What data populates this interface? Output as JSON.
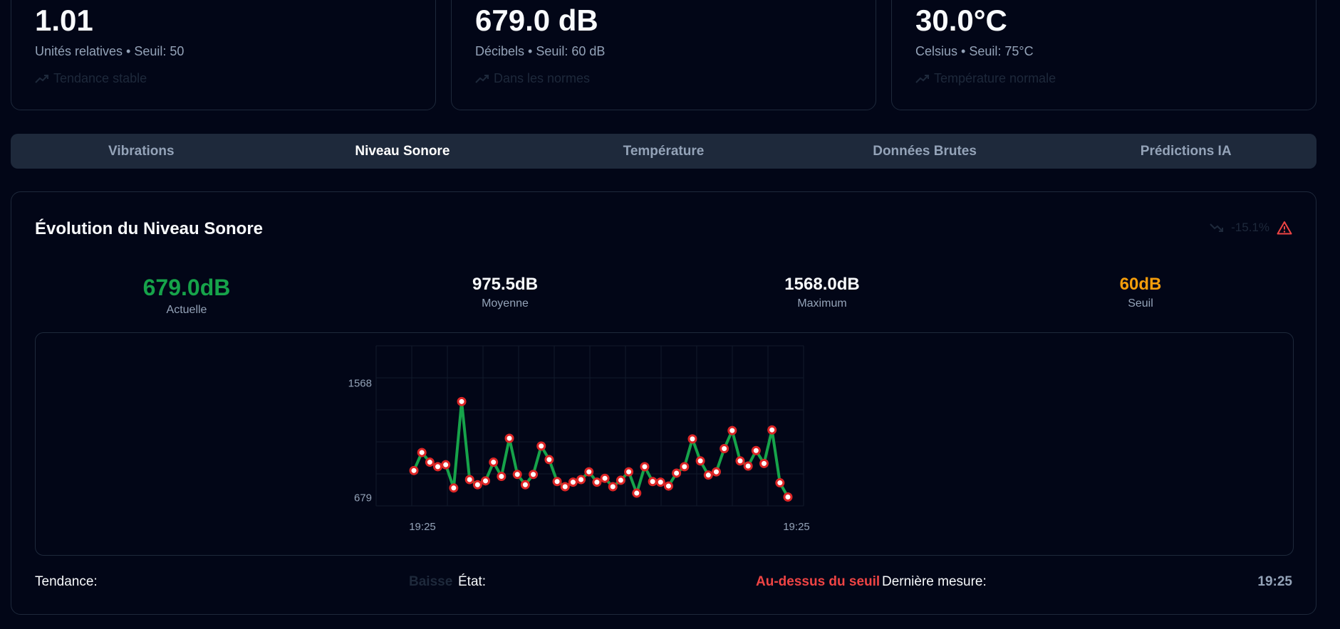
{
  "cards": [
    {
      "value": "1.01",
      "subtitle": "Unités relatives • Seuil: 50",
      "trend": "Tendance stable",
      "trend_icon": "trending-up-icon"
    },
    {
      "value": "679.0 dB",
      "subtitle": "Décibels • Seuil: 60 dB",
      "trend": "Dans les normes",
      "trend_icon": "trending-up-icon"
    },
    {
      "value": "30.0°C",
      "subtitle": "Celsius • Seuil: 75°C",
      "trend": "Température normale",
      "trend_icon": "trending-up-icon"
    }
  ],
  "tabs": [
    {
      "label": "Vibrations",
      "active": false
    },
    {
      "label": "Niveau Sonore",
      "active": true
    },
    {
      "label": "Température",
      "active": false
    },
    {
      "label": "Données Brutes",
      "active": false
    },
    {
      "label": "Prédictions IA",
      "active": false
    }
  ],
  "panel": {
    "title": "Évolution du Niveau Sonore",
    "change": "-15.1%",
    "change_icon": "trending-down-icon",
    "alert_icon": "warning-triangle-icon",
    "stats": [
      {
        "value": "679.0dB",
        "label": "Actuelle",
        "color": "#16a34a"
      },
      {
        "value": "975.5dB",
        "label": "Moyenne",
        "color": "#f8fafc"
      },
      {
        "value": "1568.0dB",
        "label": "Maximum",
        "color": "#f8fafc"
      },
      {
        "value": "60dB",
        "label": "Seuil",
        "color": "#f59e0b"
      }
    ],
    "footer": {
      "tendance_label": "Tendance:",
      "tendance_value": "Baisse",
      "etat_label": "État:",
      "etat_value": "Au-dessus du seuil",
      "derniere_label": "Dernière mesure:",
      "derniere_value": "19:25"
    }
  },
  "chart_data": {
    "type": "line",
    "x_tick_labels": [
      "19:25",
      "19:25"
    ],
    "y_tick_labels": [
      "1568",
      "679"
    ],
    "ylim": [
      616,
      1857
    ],
    "series": [
      {
        "color": "#16a34a",
        "values": [
          890,
          1030,
          955,
          920,
          935,
          755,
          1425,
          820,
          780,
          810,
          955,
          845,
          1140,
          860,
          780,
          860,
          1080,
          975,
          805,
          765,
          800,
          820,
          880,
          800,
          830,
          765,
          815,
          880,
          715,
          920,
          805,
          800,
          770,
          870,
          920,
          1135,
          965,
          855,
          880,
          1060,
          1200,
          965,
          925,
          1045,
          945,
          1205,
          795,
          685
        ]
      }
    ]
  }
}
